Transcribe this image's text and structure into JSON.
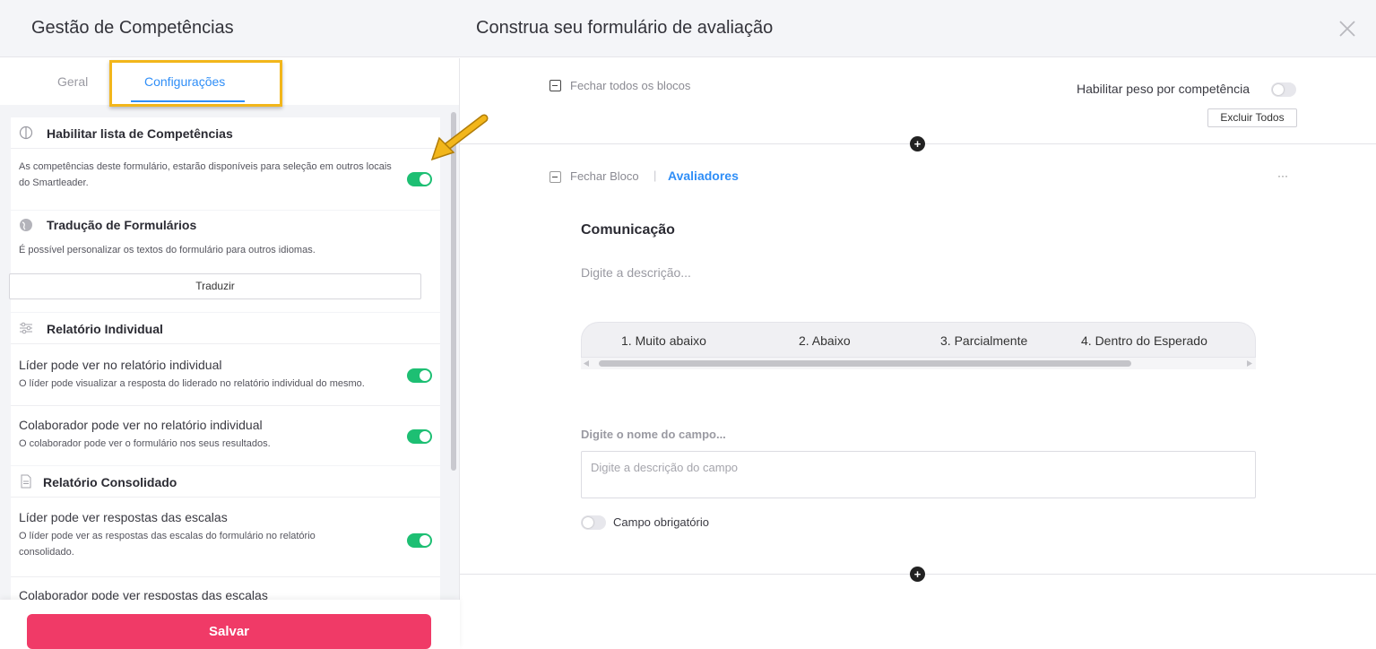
{
  "header": {
    "left_title": "Gestão de Competências",
    "main_title": "Construa seu formulário de avaliação"
  },
  "tabs": [
    {
      "label": "Geral"
    },
    {
      "label": "Configurações"
    }
  ],
  "sections": {
    "competencias": {
      "title": "Habilitar lista de Competências",
      "text": "As competências deste formulário, estarão disponíveis para seleção em outros locais do Smartleader.",
      "enabled": true
    },
    "traducao": {
      "title": "Tradução de Formulários",
      "text": "É possível personalizar os textos do formulário para outros idiomas.",
      "button": "Traduzir"
    },
    "individual": {
      "title": "Relatório Individual",
      "rows": [
        {
          "title": "Líder pode ver no relatório individual",
          "text": "O líder pode visualizar a resposta do liderado no relatório individual do mesmo.",
          "enabled": true
        },
        {
          "title": "Colaborador pode ver no relatório individual",
          "text": "O colaborador pode ver o formulário nos seus resultados.",
          "enabled": true
        }
      ]
    },
    "consolidado": {
      "title": "Relatório Consolidado",
      "rows": [
        {
          "title": "Líder pode ver respostas das escalas",
          "text": "O líder pode ver as respostas das escalas do formulário no relatório consolidado.",
          "enabled": true
        },
        {
          "title": "Colaborador pode ver respostas das escalas"
        }
      ]
    }
  },
  "save_label": "Salvar",
  "form": {
    "close_all": "Fechar todos os blocos",
    "enable_weight": "Habilitar peso por competência",
    "delete_all": "Excluir Todos",
    "close_block": "Fechar Bloco",
    "separator": "|",
    "evaluators": "Avaliadores",
    "more": "···",
    "plus": "+",
    "competency_name": "Comunicação",
    "description_placeholder": "Digite a descrição...",
    "scale": [
      "1. Muito abaixo",
      "2. Abaixo",
      "3. Parcialmente",
      "4. Dentro do Esperado"
    ],
    "field_name_placeholder": "Digite o nome do campo...",
    "field_desc_placeholder": "Digite a descrição do campo",
    "required_label": "Campo obrigatório"
  },
  "colors": {
    "accent": "#2f8ef7",
    "toggle_on": "#1dbf73",
    "save": "#f03a67",
    "highlight": "#f2b61b"
  }
}
